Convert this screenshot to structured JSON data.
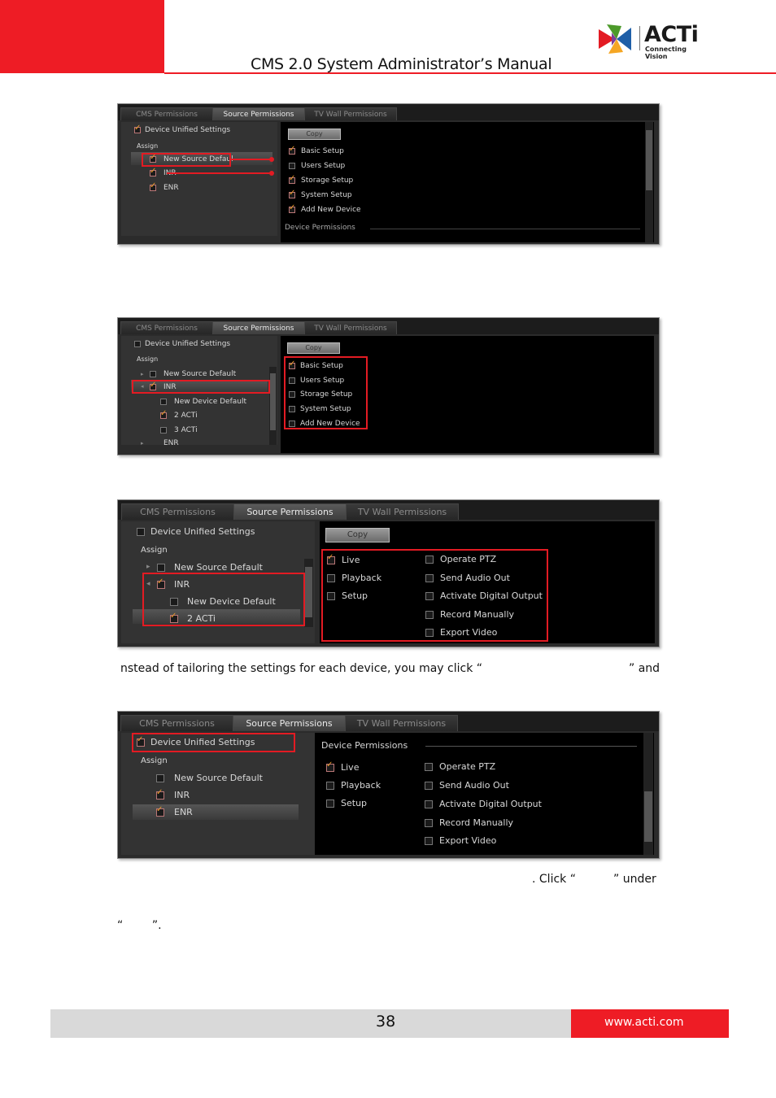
{
  "header": {
    "title": "CMS 2.0 System Administrator’s Manual",
    "logo_brand": "ACTi",
    "logo_tagline": "Connecting Vision",
    "accent": "#ee1c25"
  },
  "tabs": [
    "CMS Permissions",
    "Source Permissions",
    "TV Wall Permissions"
  ],
  "s1": {
    "unified": "Device Unified Settings",
    "assign": "Assign",
    "items": [
      "New Source Defaul",
      "INR",
      "ENR"
    ],
    "copy": "Copy",
    "perms": [
      "Basic Setup",
      "Users Setup",
      "Storage Setup",
      "System Setup",
      "Add New Device"
    ],
    "section": "Device Permissions"
  },
  "s2": {
    "unified": "Device Unified Settings",
    "assign": "Assign",
    "items": [
      "New Source Default",
      "INR",
      "New Device Default",
      "2 ACTi",
      "3 ACTi",
      "ENR"
    ],
    "copy": "Copy",
    "perms": [
      "Basic Setup",
      "Users Setup",
      "Storage Setup",
      "System Setup",
      "Add New Device"
    ]
  },
  "s3": {
    "unified": "Device Unified Settings",
    "assign": "Assign",
    "items": [
      "New Source Default",
      "INR",
      "New Device Default",
      "2 ACTi"
    ],
    "copy": "Copy",
    "perms_left": [
      "Live",
      "Playback",
      "Setup"
    ],
    "perms_right": [
      "Operate PTZ",
      "Send Audio Out",
      "Activate Digital Output",
      "Record Manually",
      "Export Video"
    ]
  },
  "s4": {
    "unified": "Device Unified Settings",
    "assign": "Assign",
    "items": [
      "New Source Default",
      "INR",
      "ENR"
    ],
    "section": "Device Permissions",
    "perms_left": [
      "Live",
      "Playback",
      "Setup"
    ],
    "perms_right": [
      "Operate PTZ",
      "Send Audio Out",
      "Activate Digital Output",
      "Record Manually",
      "Export Video"
    ]
  },
  "text": {
    "line1_a": "nstead of tailoring the settings for each device, you may click “",
    "line1_b": "” and",
    "line2_a": ". Click “",
    "line2_b": "” under",
    "line3": "“        ”."
  },
  "footer": {
    "page": "38",
    "url": "www.acti.com"
  }
}
